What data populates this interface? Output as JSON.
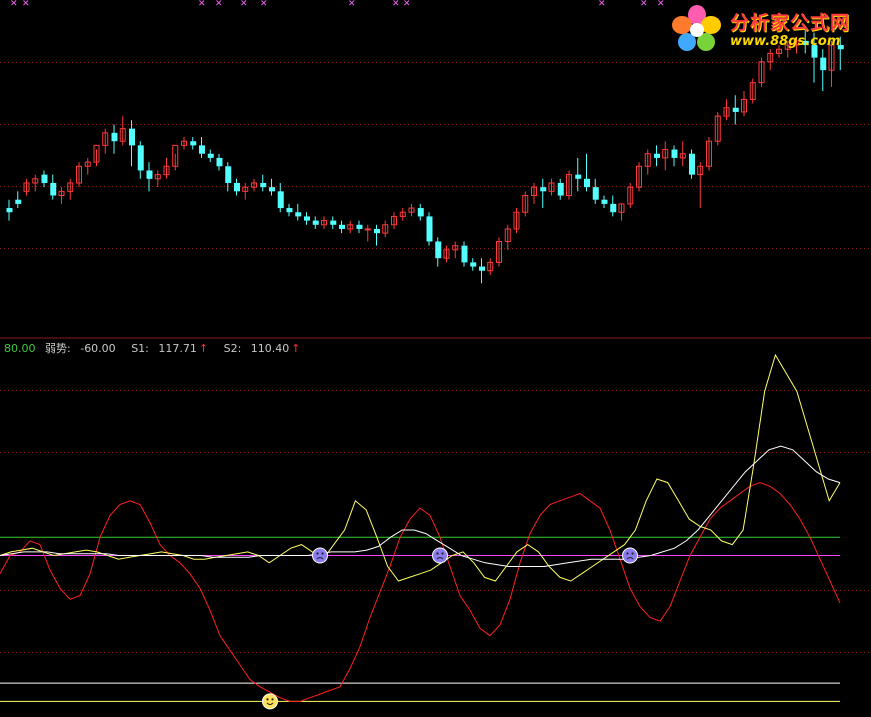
{
  "logo": {
    "title": "分析家公式网",
    "url": "www.88gs.com"
  },
  "indicator_header": {
    "level": "80.00",
    "weak_label": "弱势:",
    "weak_value": "-60.00",
    "s1_label": "S1:",
    "s1_value": "117.71",
    "s2_label": "S2:",
    "s2_value": "110.40",
    "arrow": "↑"
  },
  "colors": {
    "background": "#000000",
    "up_candle": "#ff3a3a",
    "down_candle": "#54ffff",
    "red_line": "#ff2020",
    "yellow_line": "#ffff66",
    "white_line": "#ffffff",
    "green_level": "#33cc33",
    "magenta_level": "#ff44ff",
    "grid": "#8b1a1a"
  },
  "chart_data": [
    {
      "type": "candlestick",
      "title": "",
      "ohlc": [
        [
          100,
          102,
          99,
          97
        ],
        [
          102,
          104,
          101,
          100
        ],
        [
          104,
          107,
          106,
          103
        ],
        [
          106,
          108,
          107,
          104
        ],
        [
          108,
          109,
          106,
          105
        ],
        [
          106,
          108,
          103,
          102
        ],
        [
          103,
          105,
          104,
          101
        ],
        [
          104,
          107,
          106,
          102
        ],
        [
          106,
          111,
          110,
          105
        ],
        [
          110,
          112,
          111,
          108
        ],
        [
          111,
          114,
          115,
          110
        ],
        [
          115,
          119,
          118,
          113
        ],
        [
          118,
          120,
          116,
          113
        ],
        [
          116,
          122,
          119,
          115
        ],
        [
          119,
          121,
          115,
          110
        ],
        [
          115,
          116,
          109,
          107
        ],
        [
          109,
          111,
          107,
          104
        ],
        [
          107,
          109,
          108,
          105
        ],
        [
          108,
          112,
          110,
          107
        ],
        [
          110,
          113,
          115,
          109
        ],
        [
          115,
          117,
          116,
          114
        ],
        [
          116,
          117,
          115,
          114
        ],
        [
          115,
          117,
          113,
          112
        ],
        [
          113,
          114,
          112,
          111
        ],
        [
          112,
          113,
          110,
          109
        ],
        [
          110,
          111,
          106,
          104
        ],
        [
          106,
          107,
          104,
          103
        ],
        [
          104,
          106,
          105,
          102
        ],
        [
          105,
          107,
          106,
          104
        ],
        [
          106,
          108,
          105,
          104
        ],
        [
          105,
          107,
          104,
          103
        ],
        [
          104,
          106,
          100,
          99
        ],
        [
          100,
          101,
          99,
          98
        ],
        [
          99,
          101,
          98,
          97
        ],
        [
          98,
          99,
          97,
          96
        ],
        [
          97,
          98,
          96,
          95
        ],
        [
          96,
          98,
          97,
          95
        ],
        [
          97,
          98,
          96,
          95
        ],
        [
          96,
          97,
          95,
          94
        ],
        [
          95,
          97,
          96,
          94
        ],
        [
          96,
          97,
          95,
          94
        ],
        [
          95,
          96,
          95,
          92
        ],
        [
          95,
          96,
          94,
          91
        ],
        [
          94,
          97,
          96,
          93
        ],
        [
          96,
          99,
          98,
          95
        ],
        [
          98,
          100,
          99,
          97
        ],
        [
          99,
          101,
          100,
          98
        ],
        [
          100,
          101,
          98,
          97
        ],
        [
          98,
          99,
          92,
          91
        ],
        [
          92,
          93,
          88,
          86
        ],
        [
          88,
          91,
          90,
          87
        ],
        [
          90,
          92,
          91,
          88
        ],
        [
          91,
          92,
          87,
          86
        ],
        [
          87,
          88,
          86,
          85
        ],
        [
          86,
          88,
          85,
          82
        ],
        [
          85,
          88,
          87,
          84
        ],
        [
          87,
          93,
          92,
          86
        ],
        [
          92,
          96,
          95,
          90
        ],
        [
          95,
          100,
          99,
          94
        ],
        [
          99,
          104,
          103,
          98
        ],
        [
          103,
          106,
          105,
          101
        ],
        [
          105,
          107,
          104,
          100
        ],
        [
          104,
          107,
          106,
          103
        ],
        [
          106,
          107,
          103,
          102
        ],
        [
          103,
          109,
          108,
          102
        ],
        [
          108,
          112,
          107,
          104
        ],
        [
          107,
          113,
          105,
          104
        ],
        [
          105,
          107,
          102,
          101
        ],
        [
          102,
          103,
          101,
          100
        ],
        [
          101,
          103,
          99,
          98
        ],
        [
          99,
          101,
          101,
          97
        ],
        [
          101,
          106,
          105,
          100
        ],
        [
          105,
          111,
          110,
          104
        ],
        [
          110,
          114,
          113,
          108
        ],
        [
          113,
          115,
          112,
          110
        ],
        [
          112,
          116,
          114,
          109
        ],
        [
          114,
          115,
          112,
          110
        ],
        [
          112,
          116,
          113,
          110
        ],
        [
          113,
          114,
          108,
          107
        ],
        [
          108,
          111,
          110,
          100
        ],
        [
          110,
          117,
          116,
          109
        ],
        [
          116,
          123,
          122,
          115
        ],
        [
          122,
          126,
          124,
          121
        ],
        [
          124,
          127,
          123,
          120
        ],
        [
          123,
          128,
          126,
          122
        ],
        [
          126,
          131,
          130,
          125
        ],
        [
          130,
          136,
          135,
          129
        ],
        [
          135,
          138,
          137,
          133
        ],
        [
          137,
          139,
          138,
          136
        ],
        [
          138,
          140,
          139,
          136
        ],
        [
          139,
          141,
          140,
          137
        ],
        [
          140,
          143,
          139,
          137
        ],
        [
          139,
          142,
          136,
          130
        ],
        [
          136,
          138,
          133,
          128
        ],
        [
          133,
          140,
          139,
          129
        ],
        [
          139,
          141,
          138,
          133
        ]
      ]
    },
    {
      "type": "line",
      "title": "",
      "level_lines": [
        80,
        70,
        0,
        -10
      ],
      "series": [
        {
          "name": "",
          "values": [
            60,
            70,
            72,
            78,
            76,
            62,
            52,
            46,
            48,
            60,
            80,
            92,
            98,
            100,
            98,
            88,
            76,
            70,
            66,
            60,
            52,
            40,
            26,
            18,
            10,
            2,
            -2,
            -5,
            -8,
            -10,
            -10,
            -8,
            -6,
            -4,
            -2,
            8,
            20,
            36,
            50,
            64,
            80,
            90,
            96,
            92,
            80,
            64,
            48,
            40,
            30,
            26,
            32,
            46,
            66,
            82,
            92,
            98,
            100,
            102,
            104,
            100,
            96,
            84,
            68,
            52,
            42,
            36,
            34,
            42,
            56,
            70,
            80,
            90,
            96,
            100,
            104,
            108,
            110,
            108,
            104,
            98,
            90,
            80,
            68,
            56,
            44
          ]
        },
        {
          "name": "",
          "values": [
            70,
            72,
            73,
            74,
            72,
            70,
            71,
            72,
            73,
            72,
            70,
            68,
            69,
            70,
            71,
            72,
            71,
            70,
            68,
            68,
            69,
            70,
            71,
            72,
            70,
            66,
            70,
            74,
            76,
            72,
            68,
            76,
            84,
            100,
            95,
            80,
            64,
            56,
            58,
            60,
            62,
            66,
            70,
            72,
            66,
            58,
            56,
            64,
            72,
            76,
            72,
            64,
            58,
            56,
            60,
            64,
            68,
            72,
            76,
            84,
            100,
            112,
            110,
            100,
            90,
            86,
            84,
            78,
            76,
            84,
            120,
            160,
            180,
            170,
            160,
            140,
            120,
            100,
            110
          ]
        },
        {
          "name": "",
          "values": [
            70,
            71,
            72,
            72,
            72,
            71,
            71,
            71,
            71,
            71,
            70,
            70,
            70,
            70,
            70,
            70,
            70,
            70,
            69,
            69,
            69,
            69,
            70,
            70,
            70,
            70,
            70,
            71,
            72,
            72,
            72,
            73,
            75,
            80,
            84,
            84,
            82,
            78,
            74,
            70,
            68,
            66,
            65,
            64,
            64,
            64,
            64,
            65,
            66,
            67,
            68,
            68,
            68,
            68,
            69,
            70,
            72,
            74,
            78,
            84,
            92,
            100,
            108,
            116,
            122,
            128,
            130,
            128,
            122,
            116,
            112,
            110
          ]
        }
      ],
      "markers": [
        {
          "type": "sad",
          "x_index": 32,
          "value": 70
        },
        {
          "type": "sad",
          "x_index": 44,
          "value": 70
        },
        {
          "type": "sad",
          "x_index": 63,
          "value": 70
        },
        {
          "type": "smile",
          "x_index": 27,
          "value": -10
        }
      ]
    }
  ]
}
